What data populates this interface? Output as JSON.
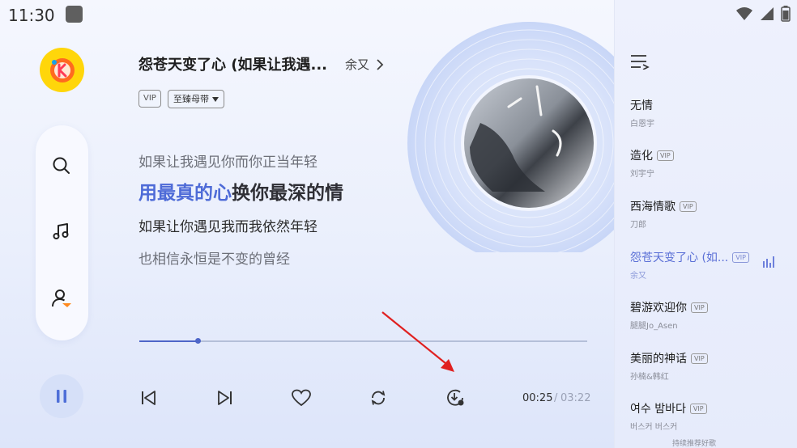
{
  "status_bar": {
    "time": "11:30",
    "icons": [
      "wifi-icon",
      "signal-icon",
      "battery-icon"
    ]
  },
  "song": {
    "title": "怨苍天变了心 (如果让我遇...",
    "artist": "余又",
    "vip_label": "VIP",
    "quality_label": "至臻母带"
  },
  "lyrics": {
    "line1": "如果让我遇见你而你正当年轻",
    "line2_highlight": "用最真的心",
    "line2_rest": "换你最深的情",
    "line3": "如果让你遇见我而我依然年轻",
    "line4": "也相信永恒是不变的曾经"
  },
  "playback": {
    "progress": 0.13,
    "current_time": "00:25",
    "separator": "/",
    "total_time": "03:22",
    "state": "playing"
  },
  "nav": {
    "items": [
      "search-icon",
      "music-note-icon",
      "profile-icon"
    ]
  },
  "controls": [
    "previous-icon",
    "next-icon",
    "heart-icon",
    "repeat-icon",
    "download-icon"
  ],
  "playlist": {
    "items": [
      {
        "title": "无情",
        "artist": "白恩宇",
        "vip": ""
      },
      {
        "title": "造化",
        "artist": "刘宇宁",
        "vip": "VIP"
      },
      {
        "title": "西海情歌",
        "artist": "刀郎",
        "vip": "VIP"
      },
      {
        "title": "怨苍天变了心 (如...",
        "artist": "余又",
        "vip": "VIP"
      },
      {
        "title": "碧游欢迎你",
        "artist": "腿腿Jo_Asen",
        "vip": "VIP"
      },
      {
        "title": "美丽的神话",
        "artist": "孙楠&韩红",
        "vip": "VIP"
      },
      {
        "title": "여수 밤바다",
        "artist": "버스커 버스커",
        "vip": "VIP"
      }
    ],
    "footer": "持续推荐好歌"
  },
  "colors": {
    "accent": "#4e6bd7",
    "logo_bg": "#ffd60a",
    "annotation_arrow": "#e02020"
  }
}
